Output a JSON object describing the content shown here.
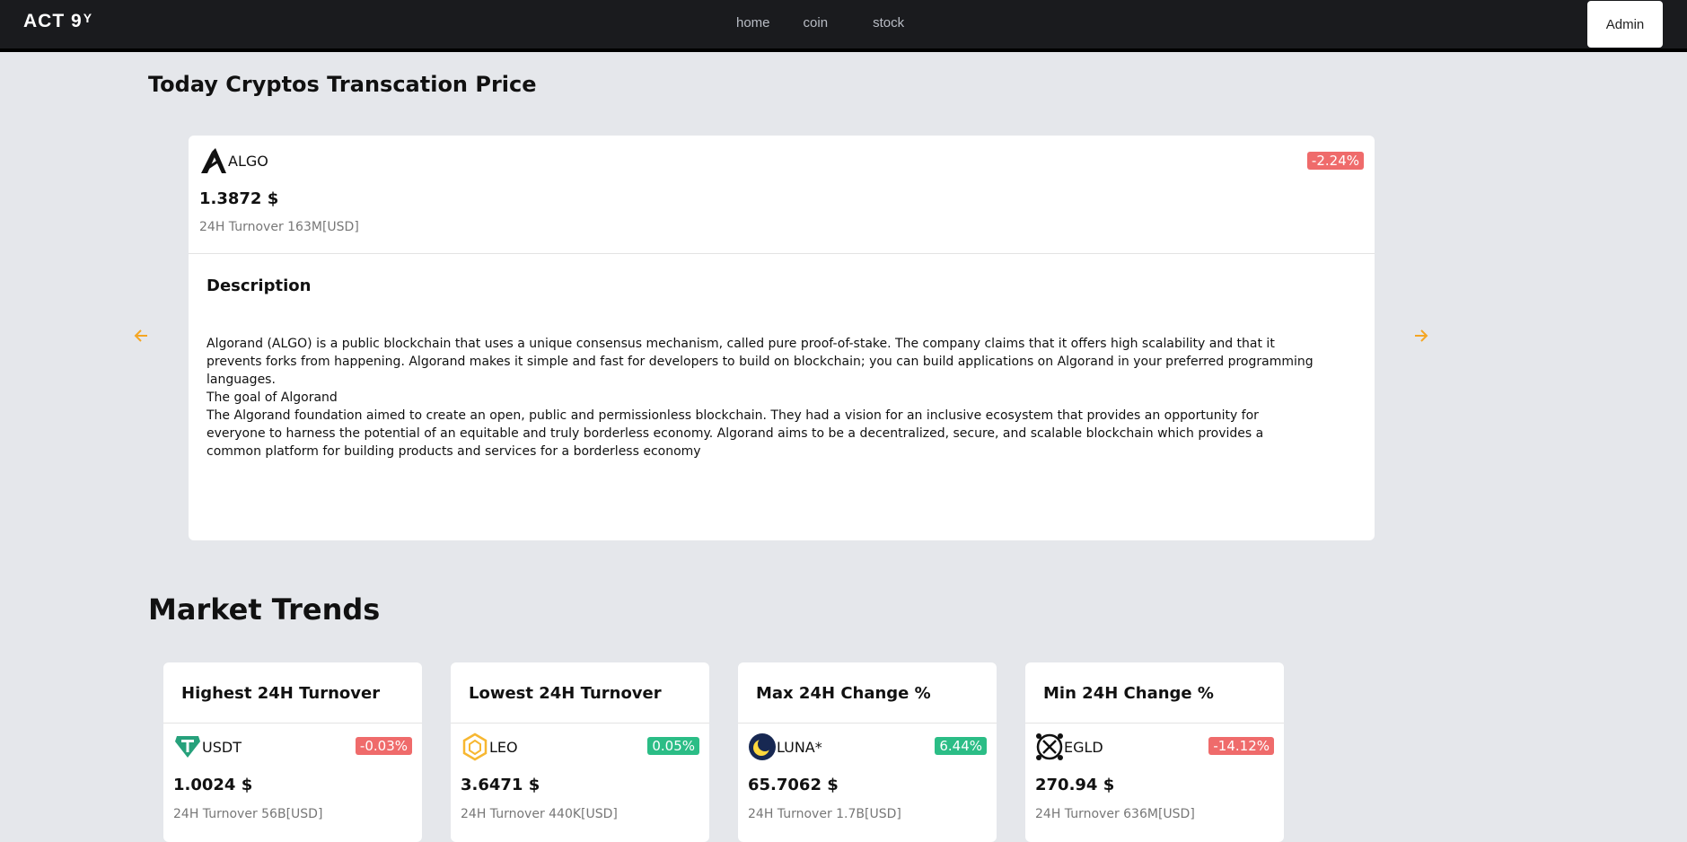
{
  "nav": {
    "logo": "ACT 9",
    "logo_mark": "Y",
    "links": [
      "home",
      "coin",
      "stock"
    ],
    "admin_label": "Admin"
  },
  "today": {
    "title": "Today Cryptos Transcation Price",
    "card": {
      "symbol": "ALGO",
      "icon": "algorand-icon",
      "change": "-2.24%",
      "change_color": "#ef6b6b",
      "price": "1.3872 $",
      "turnover": "24H Turnover 163M[USD]",
      "description_title": "Description",
      "description": "Algorand (ALGO) is a public blockchain that uses a unique consensus mechanism, called pure proof-of-stake. The company claims that it offers high scalability and that it prevents forks from happening. Algorand makes it simple and fast for developers to build on blockchain; you can build applications on Algorand in your preferred programming languages.\nThe goal of Algorand\nThe Algorand foundation aimed to create an open, public and permissionless blockchain. They had a vision for an inclusive ecosystem that provides an opportunity for everyone to harness the potential of an equitable and truly borderless economy. Algorand aims to be a decentralized, secure, and scalable blockchain which provides a common platform for building products and services for a borderless economy"
    },
    "prev_icon": "arrow-left-icon",
    "next_icon": "arrow-right-icon"
  },
  "market": {
    "title": "Market Trends",
    "cards": [
      {
        "heading": "Highest 24H Turnover",
        "symbol": "USDT",
        "icon": "tether-icon",
        "change": "-0.03%",
        "change_color": "#ef6b6b",
        "price": "1.0024 $",
        "turnover": "24H Turnover 56B[USD]"
      },
      {
        "heading": "Lowest 24H Turnover",
        "symbol": "LEO",
        "icon": "leo-icon",
        "change": "0.05%",
        "change_color": "#2bbd86",
        "price": "3.6471 $",
        "turnover": "24H Turnover 440K[USD]"
      },
      {
        "heading": "Max 24H Change %",
        "symbol": "LUNA*",
        "icon": "luna-icon",
        "change": "6.44%",
        "change_color": "#2bbd86",
        "price": "65.7062 $",
        "turnover": "24H Turnover 1.7B[USD]"
      },
      {
        "heading": "Min 24H Change %",
        "symbol": "EGLD",
        "icon": "egld-icon",
        "change": "-14.12%",
        "change_color": "#ef6b6b",
        "price": "270.94 $",
        "turnover": "24H Turnover 636M[USD]"
      }
    ]
  }
}
